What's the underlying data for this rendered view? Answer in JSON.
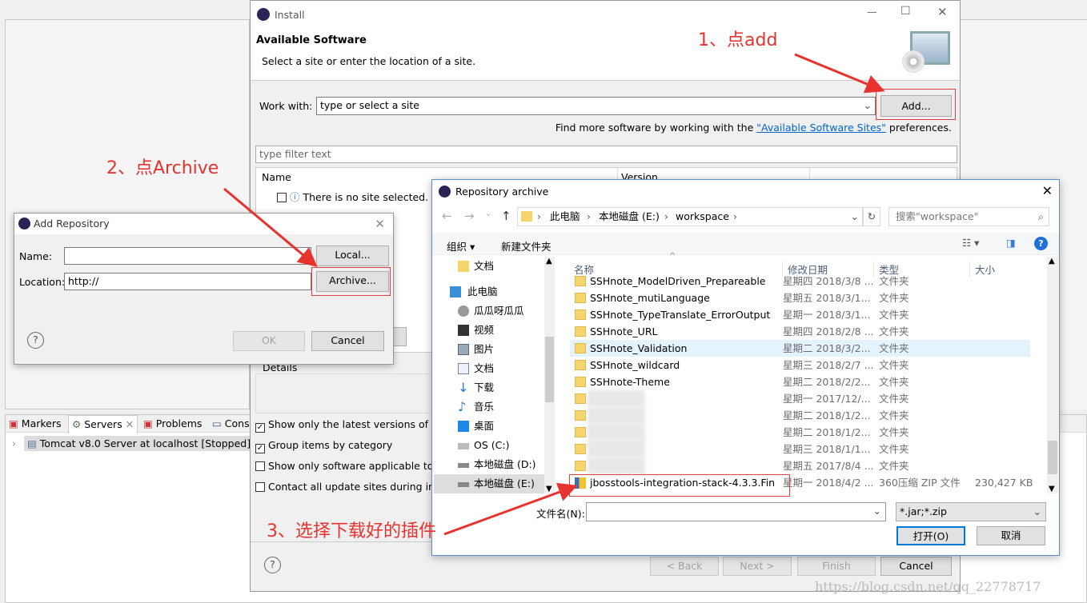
{
  "eclipse": {
    "tabs": [
      {
        "label": "Markers"
      },
      {
        "label": "Servers"
      },
      {
        "label": "Problems"
      },
      {
        "label": "Cons"
      }
    ],
    "server_row": "Tomcat v8.0 Server at localhost  [Stopped]"
  },
  "install": {
    "title": "Install",
    "header_title": "Available Software",
    "header_subtitle": "Select a site or enter the location of a site.",
    "work_with_label": "Work with:",
    "work_with_value": "type or select a site",
    "add_button": "Add...",
    "find_more_prefix": "Find more software by working with the ",
    "find_more_link": "\"Available Software Sites\"",
    "find_more_suffix": " preferences.",
    "filter_placeholder": "type filter text",
    "columns": [
      "Name",
      "Version"
    ],
    "empty_row": "There is no site selected.",
    "details_label": "Details",
    "options": [
      {
        "label": "Show only the latest versions of ava",
        "checked": true
      },
      {
        "label": "Group items by category",
        "checked": true
      },
      {
        "label": "Show only software applicable to ta",
        "checked": false
      },
      {
        "label": "Contact all update sites during insta",
        "checked": false
      }
    ],
    "buttons": {
      "back": "< Back",
      "next": "Next >",
      "finish": "Finish",
      "cancel": "Cancel"
    }
  },
  "add_repo": {
    "title": "Add Repository",
    "name_label": "Name:",
    "name_value": "",
    "location_label": "Location:",
    "location_value": "http://",
    "local_button": "Local...",
    "archive_button": "Archive...",
    "ok_button": "OK",
    "cancel_button": "Cancel"
  },
  "archive": {
    "title": "Repository archive",
    "breadcrumb": [
      "此电脑",
      "本地磁盘 (E:)",
      "workspace"
    ],
    "search_placeholder": "搜索\"workspace\"",
    "organize": "组织 ▾",
    "new_folder": "新建文件夹",
    "nav": [
      {
        "label": "文档",
        "icon": "folder-icon"
      },
      {
        "label": "此电脑",
        "icon": "computer-icon"
      },
      {
        "label": "瓜瓜呀瓜瓜",
        "icon": "user-icon"
      },
      {
        "label": "视频",
        "icon": "video-icon"
      },
      {
        "label": "图片",
        "icon": "picture-icon"
      },
      {
        "label": "文档",
        "icon": "document-icon"
      },
      {
        "label": "下载",
        "icon": "download-icon"
      },
      {
        "label": "音乐",
        "icon": "music-icon"
      },
      {
        "label": "桌面",
        "icon": "desktop-icon"
      },
      {
        "label": "OS (C:)",
        "icon": "drive-icon"
      },
      {
        "label": "本地磁盘 (D:)",
        "icon": "drive-icon"
      },
      {
        "label": "本地磁盘 (E:)",
        "icon": "drive-icon"
      }
    ],
    "columns": [
      "名称",
      "修改日期",
      "类型",
      "大小"
    ],
    "files": [
      {
        "name": "SSHnote_ModelDriven_Prepareable",
        "date": "星期四 2018/3/8 ...",
        "type": "文件夹",
        "size": ""
      },
      {
        "name": "SSHnote_mutiLanguage",
        "date": "星期五 2018/3/1...",
        "type": "文件夹",
        "size": ""
      },
      {
        "name": "SSHnote_TypeTranslate_ErrorOutput",
        "date": "星期一 2018/3/1...",
        "type": "文件夹",
        "size": ""
      },
      {
        "name": "SSHnote_URL",
        "date": "星期四 2018/2/8 ...",
        "type": "文件夹",
        "size": ""
      },
      {
        "name": "SSHnote_Validation",
        "date": "星期二 2018/3/2...",
        "type": "文件夹",
        "size": ""
      },
      {
        "name": "SSHnote_wildcard",
        "date": "星期三 2018/2/7 ...",
        "type": "文件夹",
        "size": ""
      },
      {
        "name": "SSHnote-Theme",
        "date": "星期二 2018/2/2...",
        "type": "文件夹",
        "size": ""
      },
      {
        "name": "",
        "date": "星期一 2017/12/...",
        "type": "文件夹",
        "size": ""
      },
      {
        "name": "",
        "date": "星期二 2018/1/2...",
        "type": "文件夹",
        "size": ""
      },
      {
        "name": "",
        "date": "星期二 2018/1/2...",
        "type": "文件夹",
        "size": ""
      },
      {
        "name": "",
        "date": "星期三 2018/1/1...",
        "type": "文件夹",
        "size": ""
      },
      {
        "name": "",
        "date": "星期五 2017/8/4 ...",
        "type": "文件夹",
        "size": ""
      },
      {
        "name": "jbosstools-integration-stack-4.3.3.Fin...",
        "date": "星期一 2018/4/2 ...",
        "type": "360压缩 ZIP 文件",
        "size": "230,427 KB"
      }
    ],
    "filename_label": "文件名(N):",
    "filename_value": "",
    "filter_value": "*.jar;*.zip",
    "open_button": "打开(O)",
    "cancel_button": "取消"
  },
  "annotations": {
    "step1": "1、点add",
    "step2": "2、点Archive",
    "step3": "3、选择下载好的插件",
    "color": "#e8322e"
  },
  "watermark": "https://blog.csdn.net/qq_22778717"
}
